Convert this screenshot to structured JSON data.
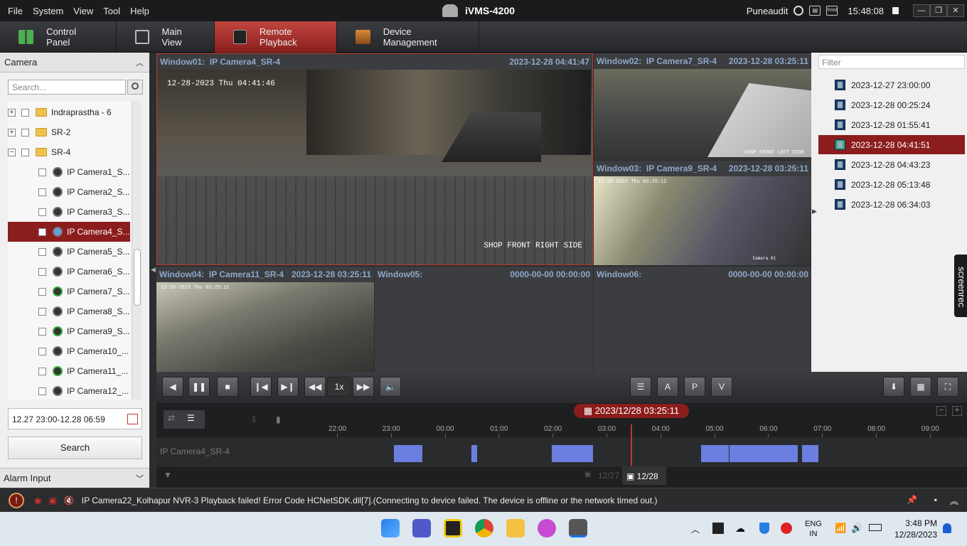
{
  "menu": [
    "File",
    "System",
    "View",
    "Tool",
    "Help"
  ],
  "app_title": "iVMS-4200",
  "user": "Puneaudit",
  "clock": "15:48:08",
  "ram_label": "RAM",
  "tabs": [
    {
      "label": "Control Panel",
      "icon": "grid-icon",
      "active": false
    },
    {
      "label": "Main View",
      "icon": "main-view-icon",
      "active": false
    },
    {
      "label": "Remote Playback",
      "icon": "playback-icon",
      "active": true
    },
    {
      "label": "Device Management",
      "icon": "device-icon",
      "active": false
    }
  ],
  "left": {
    "header": "Camera",
    "search_placeholder": "Search...",
    "tree": [
      {
        "label": "Indraprastha - 6",
        "type": "group",
        "expand": "+"
      },
      {
        "label": "SR-2",
        "type": "group",
        "expand": "+"
      },
      {
        "label": "SR-4",
        "type": "group",
        "expand": "−"
      },
      {
        "label": "IP Camera1_S...",
        "type": "camera"
      },
      {
        "label": "IP Camera2_S...",
        "type": "camera"
      },
      {
        "label": "IP Camera3_S...",
        "type": "camera"
      },
      {
        "label": "IP Camera4_S...",
        "type": "camera",
        "selected": true
      },
      {
        "label": "IP Camera5_S...",
        "type": "camera"
      },
      {
        "label": "IP Camera6_S...",
        "type": "camera"
      },
      {
        "label": "IP Camera7_S...",
        "type": "camera"
      },
      {
        "label": "IP Camera8_S...",
        "type": "camera"
      },
      {
        "label": "IP Camera9_S...",
        "type": "camera"
      },
      {
        "label": "IP Camera10_...",
        "type": "camera"
      },
      {
        "label": "IP Camera11_...",
        "type": "camera"
      },
      {
        "label": "IP Camera12_...",
        "type": "camera"
      }
    ],
    "date_range": "12.27 23:00-12.28 06:59",
    "search_button": "Search",
    "alarm_header": "Alarm Input"
  },
  "windows": [
    {
      "name": "Window01:",
      "camera": "IP Camera4_SR-4",
      "time": "2023-12-28 04:41:47",
      "osd": "12-28-2023 Thu 04:41:46",
      "osd2": "SHOP FRONT RIGHT SIDE"
    },
    {
      "name": "Window02:",
      "camera": "IP Camera7_SR-4",
      "time": "2023-12-28 03:25:11",
      "osd": "",
      "osd2": "SHOP FRONT LEFT SIDE"
    },
    {
      "name": "Window03:",
      "camera": "IP Camera9_SR-4",
      "time": "2023-12-28 03:25:11",
      "osd": "12-28-2023 Thu 03:25:11",
      "osd2": "Camera 01"
    },
    {
      "name": "Window04:",
      "camera": "IP Camera11_SR-4",
      "time": "2023-12-28 03:25:11",
      "osd": "12-28-2023 Thu 03:25:11",
      "osd2": ""
    },
    {
      "name": "Window05:",
      "camera": "",
      "time": "0000-00-00 00:00:00"
    },
    {
      "name": "Window06:",
      "camera": "",
      "time": "0000-00-00 00:00:00"
    }
  ],
  "right": {
    "filter_placeholder": "Filter",
    "records": [
      {
        "label": "2023-12-27 23:00:00"
      },
      {
        "label": "2023-12-28 00:25:24"
      },
      {
        "label": "2023-12-28 01:55:41"
      },
      {
        "label": "2023-12-28 04:41:51",
        "selected": true
      },
      {
        "label": "2023-12-28 04:43:23"
      },
      {
        "label": "2023-12-28 05:13:48"
      },
      {
        "label": "2023-12-28 06:34:03"
      }
    ],
    "screenrec": "screenrec"
  },
  "controls": {
    "speed": "1x"
  },
  "timeline": {
    "current": "2023/12/28 03:25:11",
    "ticks": [
      "22:00",
      "23:00",
      "00:00",
      "01:00",
      "02:00",
      "03:00",
      "04:00",
      "05:00",
      "06:00",
      "07:00",
      "08:00",
      "09:00"
    ],
    "camera": "IP Camera4_SR-4",
    "day_prev": "12/27",
    "day_cur": "12/28"
  },
  "status_message": "IP Camera22_Kolhapur NVR-3 Playback failed! Error Code HCNetSDK.dll[7].(Connecting to device failed. The device is offline or the network timed out.)",
  "taskbar": {
    "lang1": "ENG",
    "lang2": "IN",
    "time": "3:48 PM",
    "date": "12/28/2023"
  },
  "colors": {
    "accent": "#8b1d1d",
    "segment": "#6b7fe0",
    "header_text": "#8fa8c9"
  }
}
